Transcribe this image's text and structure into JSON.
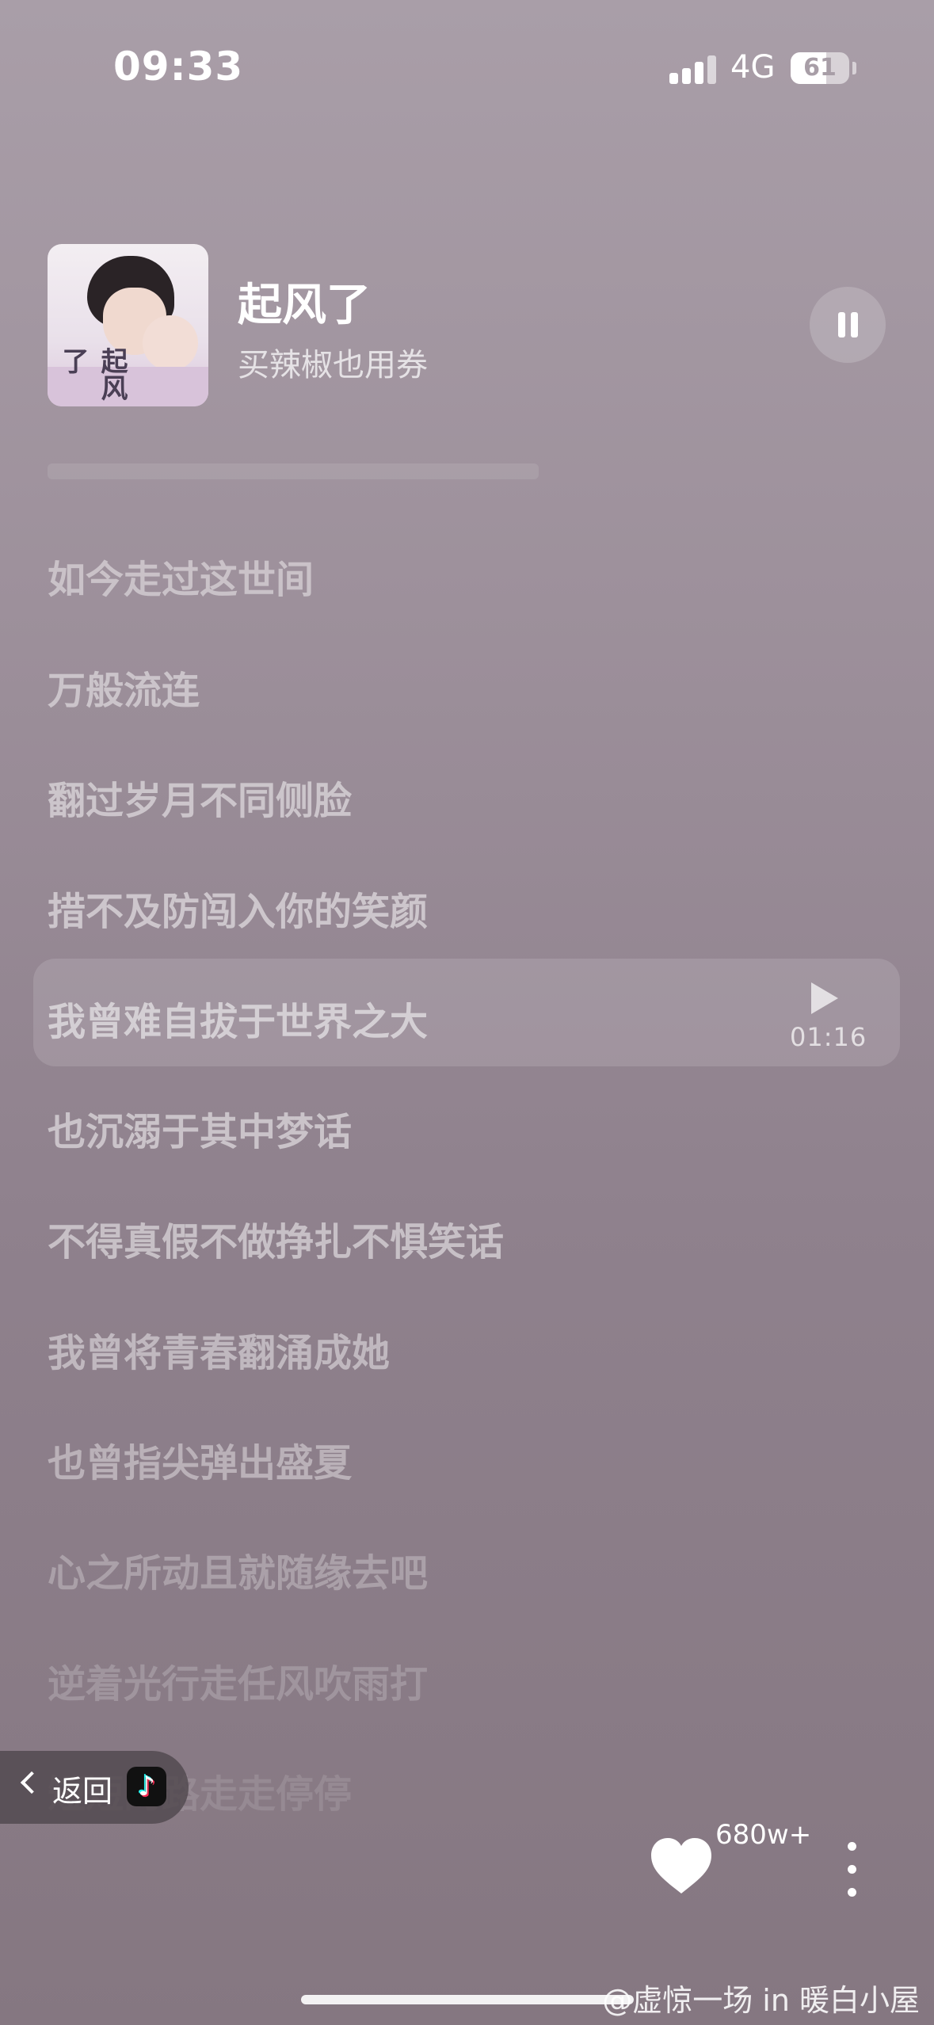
{
  "status_bar": {
    "time": "09:33",
    "network": "4G",
    "battery": "61"
  },
  "player": {
    "title": "起风了",
    "artist": "买辣椒也用券",
    "cover_glyph": "起风了"
  },
  "lyrics": [
    {
      "text": "如今走过这世间",
      "opacity": 0.45
    },
    {
      "text": "万般流连",
      "opacity": 0.48
    },
    {
      "text": "翻过岁月不同侧脸",
      "opacity": 0.5
    },
    {
      "text": "措不及防闯入你的笑颜",
      "opacity": 0.52
    },
    {
      "text": "我曾难自拔于世界之大",
      "opacity": 0.55
    },
    {
      "text": "也沉溺于其中梦话",
      "opacity": 0.52
    },
    {
      "text": "不得真假不做挣扎不惧笑话",
      "opacity": 0.5
    },
    {
      "text": "我曾将青春翻涌成她",
      "opacity": 0.45
    },
    {
      "text": "也曾指尖弹出盛夏",
      "opacity": 0.4
    },
    {
      "text": "心之所动且就随缘去吧",
      "opacity": 0.28
    },
    {
      "text": "逆着光行走任风吹雨打",
      "opacity": 0.2
    },
    {
      "text": "短短的路走走停停",
      "opacity": 0.12
    }
  ],
  "highlight_row": {
    "timestamp": "01:16"
  },
  "back": {
    "label": "返回",
    "app_icon": "tiktok-icon"
  },
  "actions": {
    "like_count": "680w+"
  },
  "watermark": "@虚惊一场 in 暖白小屋"
}
